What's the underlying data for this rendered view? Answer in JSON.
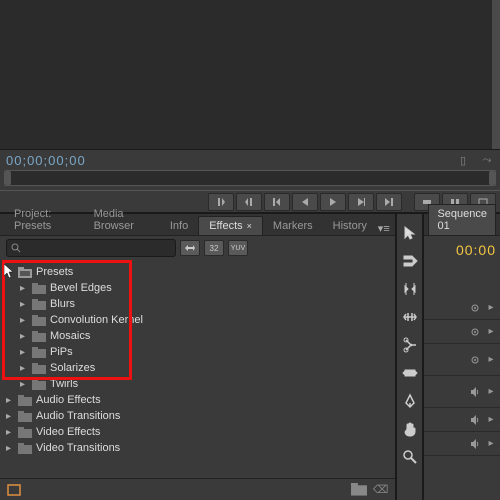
{
  "timecode": "00;00;00;00",
  "tabs": {
    "project": "Project: Presets",
    "media_browser": "Media Browser",
    "info": "Info",
    "effects": "Effects",
    "markers": "Markers",
    "history": "History"
  },
  "search": {
    "placeholder": ""
  },
  "filter_buttons": {
    "a": "⟳",
    "b": "32",
    "c": "YUV"
  },
  "tree": {
    "root": {
      "label": "Presets"
    },
    "children": [
      {
        "label": "Bevel Edges"
      },
      {
        "label": "Blurs"
      },
      {
        "label": "Convolution Kernel"
      },
      {
        "label": "Mosaics"
      },
      {
        "label": "PiPs"
      },
      {
        "label": "Solarizes"
      },
      {
        "label": "Twirls"
      }
    ],
    "siblings": [
      {
        "label": "Audio Effects"
      },
      {
        "label": "Audio Transitions"
      },
      {
        "label": "Video Effects"
      },
      {
        "label": "Video Transitions"
      }
    ]
  },
  "sequence": {
    "tab": "Sequence 01",
    "time": "00:00"
  }
}
